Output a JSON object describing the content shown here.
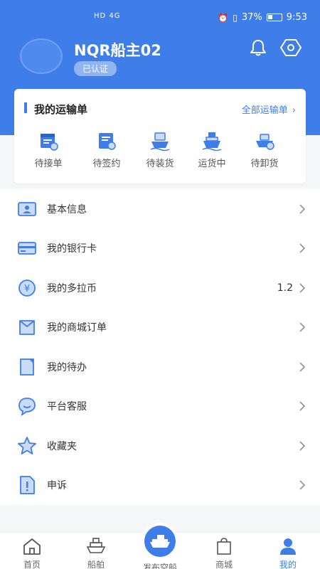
{
  "status_bar": {
    "network": "HD 4G",
    "battery": "37%",
    "time": "9:53"
  },
  "profile": {
    "username": "NQR船主02",
    "verified_label": "已认证"
  },
  "orders_card": {
    "title": "我的运输单",
    "all_link": "全部运输单",
    "items": [
      {
        "label": "待接单",
        "icon": "pending-accept-icon"
      },
      {
        "label": "待签约",
        "icon": "pending-sign-icon"
      },
      {
        "label": "待装货",
        "icon": "pending-load-icon"
      },
      {
        "label": "运货中",
        "icon": "shipping-icon"
      },
      {
        "label": "待卸货",
        "icon": "pending-unload-icon"
      }
    ]
  },
  "menu": [
    {
      "label": "基本信息",
      "icon": "id-card-icon",
      "value": ""
    },
    {
      "label": "我的银行卡",
      "icon": "bank-card-icon",
      "value": ""
    },
    {
      "label": "我的多拉币",
      "icon": "coin-icon",
      "value": "1.2"
    },
    {
      "label": "我的商城订单",
      "icon": "shop-order-icon",
      "value": ""
    },
    {
      "label": "我的待办",
      "icon": "todo-icon",
      "value": ""
    },
    {
      "label": "平台客服",
      "icon": "chat-icon",
      "value": ""
    },
    {
      "label": "收藏夹",
      "icon": "star-icon",
      "value": ""
    },
    {
      "label": "申诉",
      "icon": "appeal-icon",
      "value": ""
    }
  ],
  "tabbar": {
    "tabs": [
      {
        "label": "首页",
        "icon": "home-icon"
      },
      {
        "label": "船舶",
        "icon": "ship-icon"
      },
      {
        "label": "发布空船",
        "icon": "publish-ship-icon"
      },
      {
        "label": "商城",
        "icon": "shopping-bag-icon"
      },
      {
        "label": "我的",
        "icon": "user-icon"
      }
    ],
    "active_index": 4
  },
  "colors": {
    "primary": "#3f7de8",
    "primary_light": "#8fb4f0",
    "icon_fill": "#c9dbf8"
  }
}
